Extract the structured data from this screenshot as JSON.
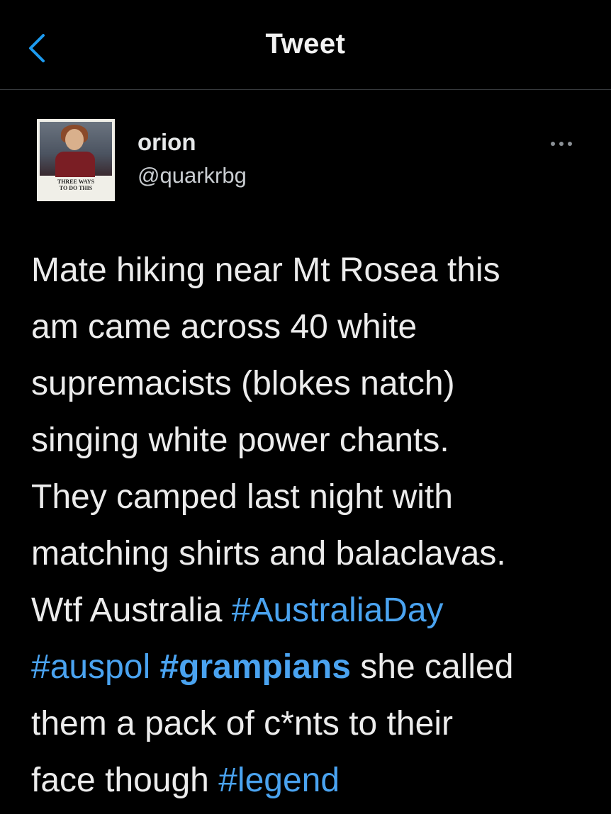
{
  "header": {
    "title": "Tweet",
    "back_icon": "chevron-left-icon",
    "accent_color": "#1d9bf0"
  },
  "author": {
    "name": "orion",
    "handle": "@quarkrbg",
    "avatar_caption_line1": "THREE WAYS",
    "avatar_caption_line2": "TO DO THIS",
    "more_icon": "ellipsis-icon"
  },
  "tweet": {
    "lines": [
      [
        {
          "text": "Mate hiking near Mt Rosea this"
        }
      ],
      [
        {
          "text": "am came across 40 white"
        }
      ],
      [
        {
          "text": "supremacists (blokes natch)"
        }
      ],
      [
        {
          "text": "singing white power chants."
        }
      ],
      [
        {
          "text": "They camped last night with"
        }
      ],
      [
        {
          "text": "matching shirts and balaclavas."
        }
      ],
      [
        {
          "text": "Wtf Australia "
        },
        {
          "text": "#AustraliaDay",
          "hashtag": true
        }
      ],
      [
        {
          "text": "#auspol",
          "hashtag": true
        },
        {
          "text": " "
        },
        {
          "text": "#grampians",
          "hashtag": true,
          "bold": true
        },
        {
          "text": " she called"
        }
      ],
      [
        {
          "text": "them a pack of c*nts to their"
        }
      ],
      [
        {
          "text": "face though "
        },
        {
          "text": "#legend",
          "hashtag": true
        }
      ]
    ],
    "hashtag_color": "#4aa3f0"
  }
}
